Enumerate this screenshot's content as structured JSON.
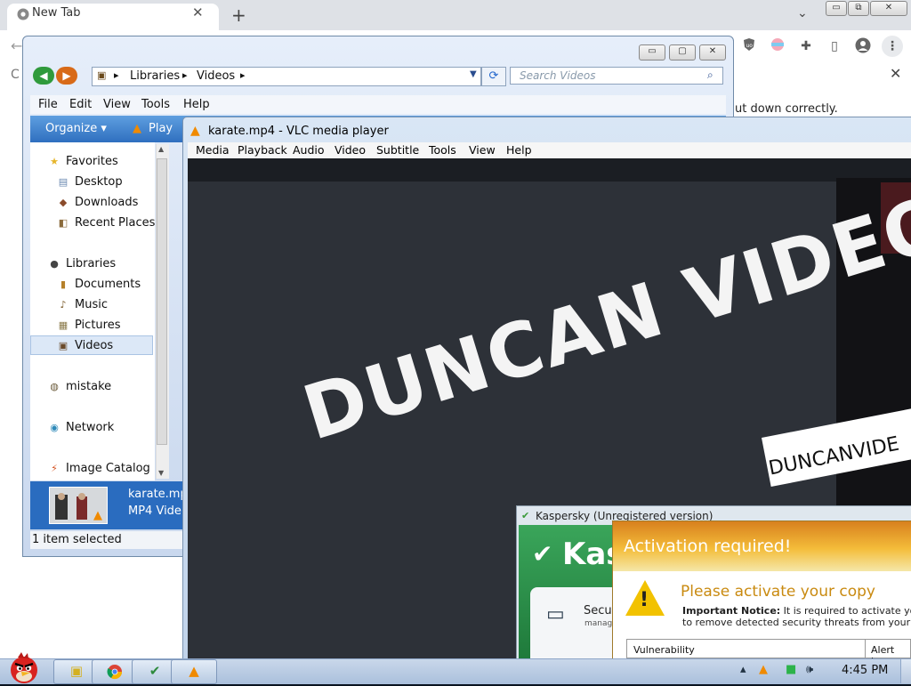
{
  "chrome": {
    "tab_title": "New Tab",
    "tab_close": "✕",
    "new_tab": "+",
    "tab_search": "⌄",
    "window_buttons": [
      "▭",
      "⧉",
      "✕"
    ],
    "infobar_text": "ut down correctly.",
    "infobar_close": "✕",
    "extensions": [
      "uBlock-icon",
      "flag-icon",
      "puzzle-icon",
      "sidepanel-icon",
      "profile-icon",
      "kebab-icon"
    ]
  },
  "explorer": {
    "breadcrumb": [
      "Libraries",
      "Videos"
    ],
    "search_placeholder": "Search Videos",
    "menu": [
      "File",
      "Edit",
      "View",
      "Tools",
      "Help"
    ],
    "commands": {
      "organize": "Organize ▾",
      "play": "Play"
    },
    "window_buttons": [
      "▭",
      "▢",
      "✕"
    ],
    "nav": {
      "favorites": "Favorites",
      "desktop": "Desktop",
      "downloads": "Downloads",
      "recent": "Recent Places",
      "libraries": "Libraries",
      "documents": "Documents",
      "music": "Music",
      "pictures": "Pictures",
      "videos": "Videos",
      "mistake": "mistake",
      "network": "Network",
      "catalog": "Image Catalog"
    },
    "details": {
      "name": "karate.mp",
      "type": "MP4 Vide"
    },
    "status": "1 item selected"
  },
  "vlc": {
    "title": "karate.mp4 - VLC media player",
    "menu": [
      "Media",
      "Playback",
      "Audio",
      "Video",
      "Subtitle",
      "Tools",
      "View",
      "Help"
    ],
    "video_big_text": "DUNCAN VIDEO",
    "video_banner_text": "DUNCANVIDE"
  },
  "kaspersky": {
    "title": "Kaspersky (Unregistered version)",
    "logo": "Kas",
    "section": "Secur",
    "section_sub": "manag"
  },
  "activation": {
    "title": "Activation required!",
    "heading": "Please activate your copy",
    "notice_label": "Important Notice:",
    "notice_line1": " It is required to activate your c",
    "notice_line2": "to remove detected security threats from your com",
    "col1": "Vulnerability",
    "col2": "Alert leve"
  },
  "taskbar": {
    "time": "4:45 PM"
  },
  "colors": {
    "explorer_cmdbar": "#2f6fbf",
    "vlc_orange": "#f08a00",
    "kaspersky_green": "#1f7a3b",
    "activation_orange": "#d8801e"
  }
}
